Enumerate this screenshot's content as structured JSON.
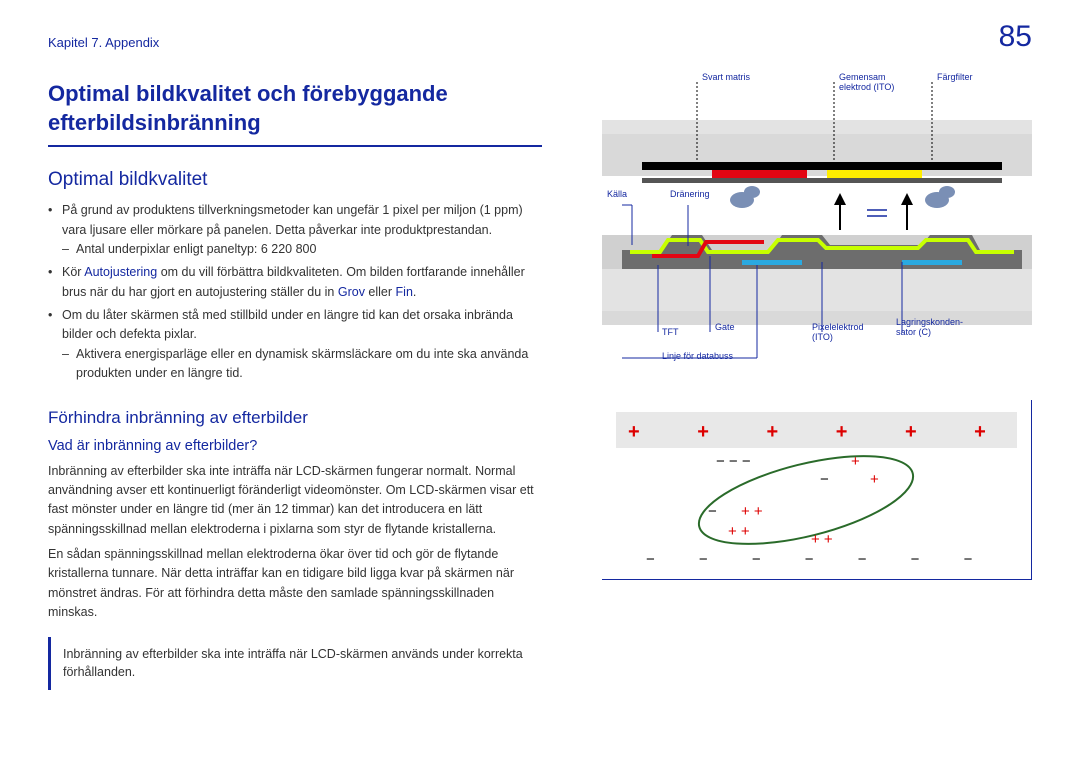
{
  "header": {
    "chapter": "Kapitel 7. Appendix",
    "page": "85"
  },
  "h1": "Optimal bildkvalitet och förebyggande efterbildsinbränning",
  "h2a": "Optimal bildkvalitet",
  "b1": "På grund av produktens tillverkningsmetoder kan ungefär 1 pixel per miljon (1 ppm) vara ljusare eller mörkare på panelen. Detta påverkar inte produktprestandan.",
  "b1s": "Antal underpixlar enligt paneltyp: 6 220 800",
  "b2a": "Kör ",
  "b2link": "Autojustering",
  "b2b": " om du vill förbättra bildkvaliteten. Om bilden fortfarande innehåller brus när du har gjort en autojustering ställer du in ",
  "b2g": "Grov",
  "b2or": " eller ",
  "b2f": "Fin",
  "b2end": ".",
  "b3": "Om du låter skärmen stå med stillbild under en längre tid kan det orsaka inbrända bilder och defekta pixlar.",
  "b3s": "Aktivera energisparläge eller en dynamisk skärmsläckare om du inte ska använda produkten under en längre tid.",
  "h3": "Förhindra inbränning av efterbilder",
  "h4": "Vad är inbränning av efterbilder?",
  "p1": "Inbränning av efterbilder ska inte inträffa när LCD-skärmen fungerar normalt. Normal användning avser ett kontinuerligt föränderligt videomönster. Om LCD-skärmen visar ett fast mönster under en längre tid (mer än 12 timmar) kan det introducera en lätt spänningsskillnad mellan elektroderna i pixlarna som styr de flytande kristallerna.",
  "p2": "En sådan spänningsskillnad mellan elektroderna ökar över tid och gör de flytande kristallerna tunnare. När detta inträffar kan en tidigare bild ligga kvar på skärmen när mönstret ändras. För att förhindra detta måste den samlade spänningsskillnaden minskas.",
  "note": "Inbränning av efterbilder ska inte inträffa när LCD-skärmen används under korrekta förhållanden.",
  "diag": {
    "svart": "Svart matris",
    "gemensam": "Gemensam elektrod (ITO)",
    "farg": "Färgfilter",
    "kalla": "Källa",
    "dranering": "Dränering",
    "tft": "TFT",
    "gate": "Gate",
    "pixel": "Pixelelektrod (ITO)",
    "lagring": "Lagringskonden-sator (C)",
    "linje": "Linje för databuss"
  }
}
